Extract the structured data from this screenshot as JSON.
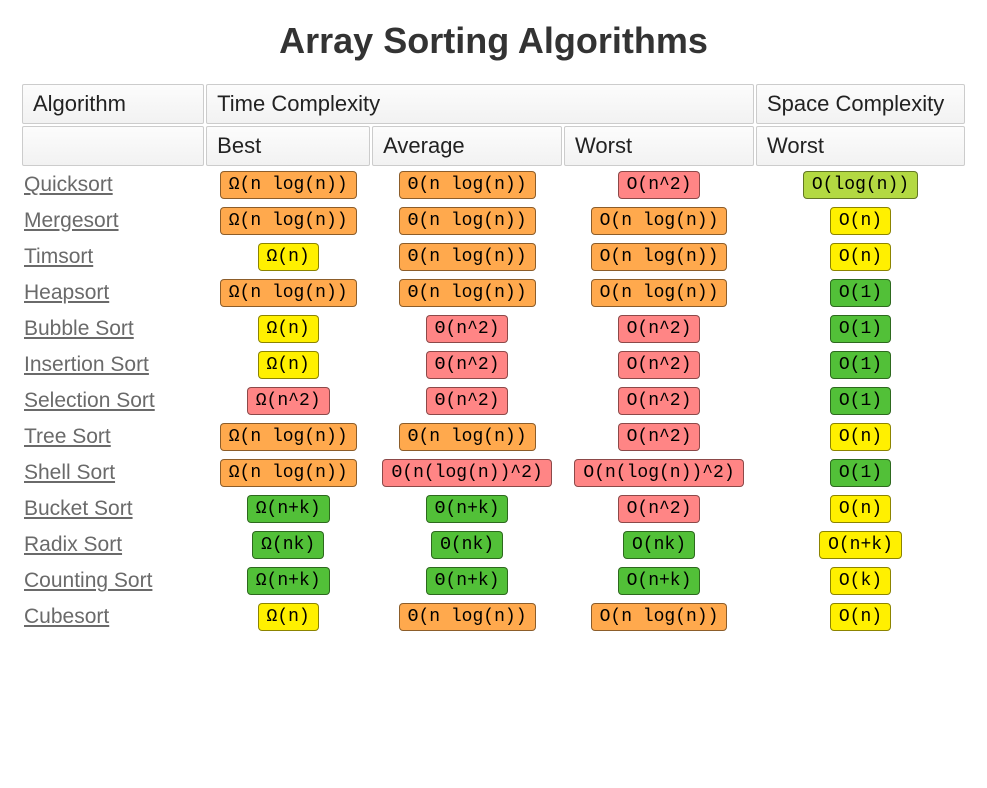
{
  "title": "Array Sorting Algorithms",
  "headers": {
    "algorithm": "Algorithm",
    "time": "Time Complexity",
    "space": "Space Complexity",
    "best": "Best",
    "average": "Average",
    "worst": "Worst",
    "space_worst": "Worst"
  },
  "rows": [
    {
      "name": "Quicksort",
      "best": "Ω(n log(n))",
      "best_c": "orange",
      "avg": "Θ(n log(n))",
      "avg_c": "orange",
      "worst": "O(n^2)",
      "worst_c": "red",
      "space": "O(log(n))",
      "space_c": "yellowgreen"
    },
    {
      "name": "Mergesort",
      "best": "Ω(n log(n))",
      "best_c": "orange",
      "avg": "Θ(n log(n))",
      "avg_c": "orange",
      "worst": "O(n log(n))",
      "worst_c": "orange",
      "space": "O(n)",
      "space_c": "yellow"
    },
    {
      "name": "Timsort",
      "best": "Ω(n)",
      "best_c": "yellow",
      "avg": "Θ(n log(n))",
      "avg_c": "orange",
      "worst": "O(n log(n))",
      "worst_c": "orange",
      "space": "O(n)",
      "space_c": "yellow"
    },
    {
      "name": "Heapsort",
      "best": "Ω(n log(n))",
      "best_c": "orange",
      "avg": "Θ(n log(n))",
      "avg_c": "orange",
      "worst": "O(n log(n))",
      "worst_c": "orange",
      "space": "O(1)",
      "space_c": "green"
    },
    {
      "name": "Bubble Sort",
      "best": "Ω(n)",
      "best_c": "yellow",
      "avg": "Θ(n^2)",
      "avg_c": "red",
      "worst": "O(n^2)",
      "worst_c": "red",
      "space": "O(1)",
      "space_c": "green"
    },
    {
      "name": "Insertion Sort",
      "best": "Ω(n)",
      "best_c": "yellow",
      "avg": "Θ(n^2)",
      "avg_c": "red",
      "worst": "O(n^2)",
      "worst_c": "red",
      "space": "O(1)",
      "space_c": "green"
    },
    {
      "name": "Selection Sort",
      "best": "Ω(n^2)",
      "best_c": "red",
      "avg": "Θ(n^2)",
      "avg_c": "red",
      "worst": "O(n^2)",
      "worst_c": "red",
      "space": "O(1)",
      "space_c": "green"
    },
    {
      "name": "Tree Sort",
      "best": "Ω(n log(n))",
      "best_c": "orange",
      "avg": "Θ(n log(n))",
      "avg_c": "orange",
      "worst": "O(n^2)",
      "worst_c": "red",
      "space": "O(n)",
      "space_c": "yellow"
    },
    {
      "name": "Shell Sort",
      "best": "Ω(n log(n))",
      "best_c": "orange",
      "avg": "Θ(n(log(n))^2)",
      "avg_c": "red",
      "worst": "O(n(log(n))^2)",
      "worst_c": "red",
      "space": "O(1)",
      "space_c": "green"
    },
    {
      "name": "Bucket Sort",
      "best": "Ω(n+k)",
      "best_c": "green",
      "avg": "Θ(n+k)",
      "avg_c": "green",
      "worst": "O(n^2)",
      "worst_c": "red",
      "space": "O(n)",
      "space_c": "yellow"
    },
    {
      "name": "Radix Sort",
      "best": "Ω(nk)",
      "best_c": "green",
      "avg": "Θ(nk)",
      "avg_c": "green",
      "worst": "O(nk)",
      "worst_c": "green",
      "space": "O(n+k)",
      "space_c": "yellow"
    },
    {
      "name": "Counting Sort",
      "best": "Ω(n+k)",
      "best_c": "green",
      "avg": "Θ(n+k)",
      "avg_c": "green",
      "worst": "O(n+k)",
      "worst_c": "green",
      "space": "O(k)",
      "space_c": "yellow"
    },
    {
      "name": "Cubesort",
      "best": "Ω(n)",
      "best_c": "yellow",
      "avg": "Θ(n log(n))",
      "avg_c": "orange",
      "worst": "O(n log(n))",
      "worst_c": "orange",
      "space": "O(n)",
      "space_c": "yellow"
    }
  ]
}
